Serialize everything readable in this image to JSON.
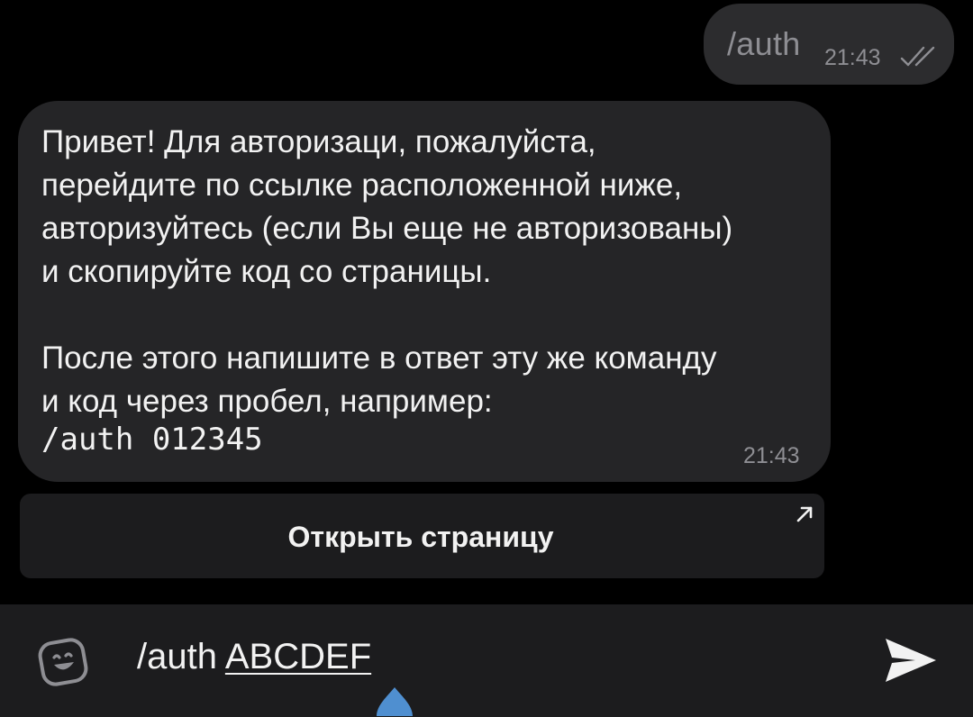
{
  "outgoing_message": {
    "text": "/auth",
    "time": "21:43",
    "status_icon": "double-check-icon"
  },
  "incoming_message": {
    "lines": [
      "Привет! Для авторизаци, пожалуйста,",
      "перейдите по ссылке расположенной ниже,",
      "авторизуйтесь (если Вы еще не авторизованы)",
      "и скопируйте код со страницы.",
      "",
      "После этого напишите в ответ эту же команду",
      "и код через пробел, например:"
    ],
    "code": "/auth 012345",
    "time": "21:43"
  },
  "inline_button": {
    "label": "Открыть страницу",
    "icon": "open-link-arrow-icon"
  },
  "input_bar": {
    "emoji_icon": "emoji-sticker-icon",
    "typed_prefix": "/auth ",
    "typed_underlined": "ABCDEF",
    "send_icon": "send-icon"
  },
  "colors": {
    "background": "#000000",
    "outgoing_bubble": "#2c2c2e",
    "incoming_bubble": "#252527",
    "button_bg": "#1c1c1e",
    "input_bar_bg": "#1c1c1e",
    "text_primary": "#f2f2f2",
    "text_secondary": "#8e8e93",
    "cursor_handle": "#4f8fd0"
  }
}
